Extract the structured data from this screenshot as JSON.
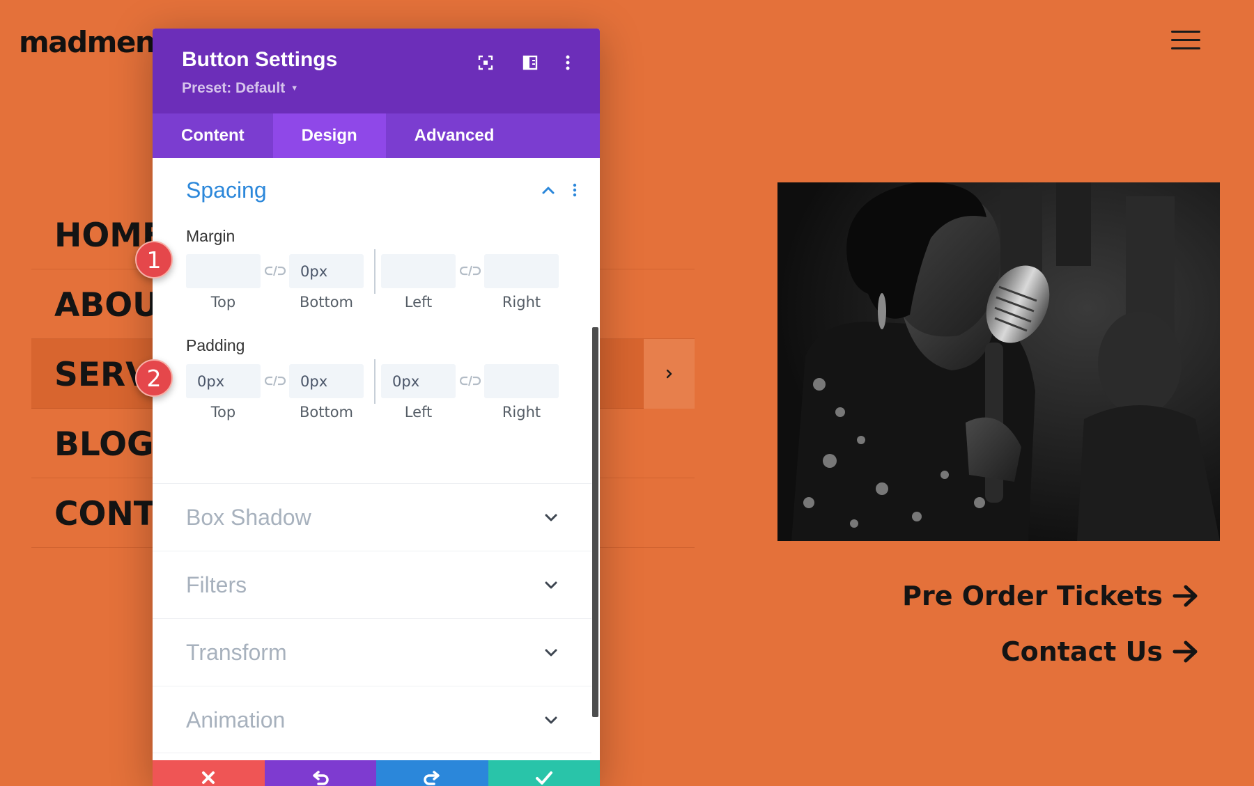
{
  "site": {
    "logo": "madmenu",
    "nav": [
      "HOME",
      "ABOUT",
      "SERVICES",
      "BLOG",
      "CONTACT"
    ],
    "cta": [
      "Pre Order Tickets",
      "Contact Us"
    ]
  },
  "modal": {
    "title": "Button Settings",
    "preset": "Preset: Default",
    "header_icons": [
      "fullscreen-icon",
      "split-view-icon",
      "more-options-icon"
    ],
    "tabs": [
      "Content",
      "Design",
      "Advanced"
    ],
    "active_tab": "Design",
    "spacing": {
      "title": "Spacing",
      "margin": {
        "label": "Margin",
        "values": [
          "",
          "0px",
          "",
          ""
        ],
        "captions": [
          "Top",
          "Bottom",
          "Left",
          "Right"
        ]
      },
      "padding": {
        "label": "Padding",
        "values": [
          "0px",
          "0px",
          "0px",
          ""
        ],
        "captions": [
          "Top",
          "Bottom",
          "Left",
          "Right"
        ]
      }
    },
    "sections": [
      "Box Shadow",
      "Filters",
      "Transform",
      "Animation"
    ],
    "footer_actions": [
      "cancel",
      "undo",
      "redo",
      "save"
    ]
  },
  "badges": [
    "1",
    "2"
  ],
  "colors": {
    "page_bg": "#e4713a",
    "modal_header": "#6c2eb9",
    "tab_bar": "#7b3dd0",
    "tab_active": "#8f48e8",
    "accent_blue": "#2b87da",
    "cancel": "#ef5555",
    "undo": "#7e3bd0",
    "redo": "#2b87da",
    "save": "#29c4a9",
    "badge": "#e5474b"
  }
}
